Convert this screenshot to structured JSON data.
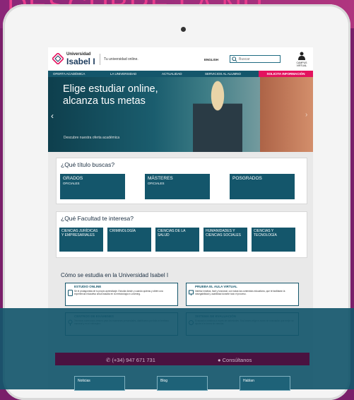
{
  "banner": {
    "text": "DESCUBRE LA NU"
  },
  "header": {
    "logo_small": "Universidad",
    "logo_big": "Isabel I",
    "tagline": "Tu universidad online.",
    "lang_link": "ENGLISH",
    "search_placeholder": "Buscar",
    "campus_label": "CAMPUS VIRTUAL"
  },
  "nav": {
    "items": [
      "OFERTA ACADÉMICA",
      "LA UNIVERSIDAD",
      "ACTUALIDAD",
      "SERVICIOS AL ALUMNO"
    ],
    "cta": "SOLICITA INFORMACIÓN"
  },
  "hero": {
    "title_line1": "Elige estudiar online,",
    "title_line2": "alcanza tus metas",
    "subtitle": "Descubre nuestra oferta académica"
  },
  "titles": {
    "heading": "¿Qué título buscas?",
    "tiles": [
      {
        "main": "GRADOS",
        "sub": "OFICIALES"
      },
      {
        "main": "MÁSTERES",
        "sub": "OFICIALES"
      },
      {
        "main": "POSGRADOS",
        "sub": ""
      }
    ]
  },
  "faculties": {
    "heading": "¿Qué Facultad te interesa?",
    "tiles": [
      "CIENCIAS JURÍDICAS Y EMPRESARIALES",
      "CRIMINOLOGÍA",
      "CIENCIAS DE LA SALUD",
      "HUMANIDADES Y CIENCIAS SOCIALES",
      "CIENCIAS Y TECNOLOGÍA"
    ]
  },
  "how": {
    "heading": "Cómo se estudia en la Universidad Isabel I",
    "boxes": [
      {
        "title": "ESTUDIO ONLINE",
        "text": "Sé el protagonista de tu propio aprendizaje. Estudia dónde y cuando quieras y obtén una experiencia educativa única basada en la metodología e-Learning."
      },
      {
        "title": "PRUEBA EL AULA VIRTUAL",
        "text": "Interfaz intuitiva, fácil y funcional, con todas las contenidos educativos, que te facilitarán la navegabilidad y usabilidad durante todo el proceso."
      },
      {
        "title": "CENTROS DE EXÁMENES",
        "text": "Tenemos numerosos centros para los exámenes presenciales, distribuidos por todo el territorio nacional y en el extranjero."
      },
      {
        "title": "SISTEMA DE EVALUACIÓN",
        "text": "Evaluación continua a través de actividades. Sus tutores elige el modo de evaluación que mejor se ajuste a tu forma de estudiar."
      }
    ]
  },
  "contact": {
    "phone": "(+34) 947 671 731",
    "cta": "Consúltanos"
  },
  "footer": {
    "boxes": [
      "Noticias",
      "Blog",
      "Hablan"
    ]
  },
  "colors": {
    "primary": "#14566b",
    "accent": "#e3125e",
    "banner": "#e83d8d"
  }
}
